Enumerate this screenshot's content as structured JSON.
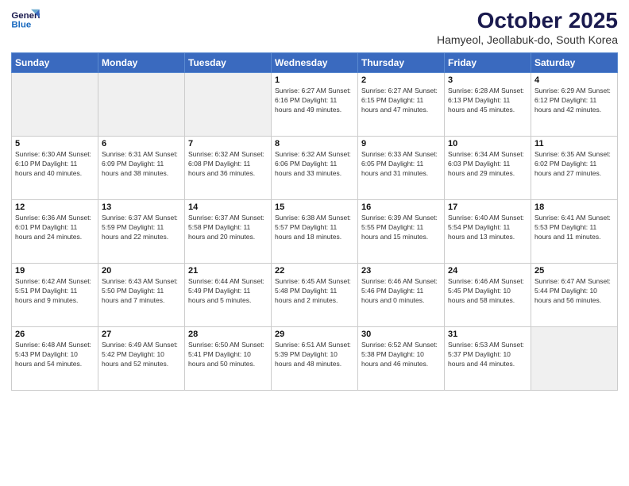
{
  "header": {
    "logo_line1": "General",
    "logo_line2": "Blue",
    "month": "October 2025",
    "location": "Hamyeol, Jeollabuk-do, South Korea"
  },
  "weekdays": [
    "Sunday",
    "Monday",
    "Tuesday",
    "Wednesday",
    "Thursday",
    "Friday",
    "Saturday"
  ],
  "weeks": [
    [
      {
        "day": "",
        "info": "",
        "empty": true
      },
      {
        "day": "",
        "info": "",
        "empty": true
      },
      {
        "day": "",
        "info": "",
        "empty": true
      },
      {
        "day": "1",
        "info": "Sunrise: 6:27 AM\nSunset: 6:16 PM\nDaylight: 11 hours\nand 49 minutes.",
        "empty": false
      },
      {
        "day": "2",
        "info": "Sunrise: 6:27 AM\nSunset: 6:15 PM\nDaylight: 11 hours\nand 47 minutes.",
        "empty": false
      },
      {
        "day": "3",
        "info": "Sunrise: 6:28 AM\nSunset: 6:13 PM\nDaylight: 11 hours\nand 45 minutes.",
        "empty": false
      },
      {
        "day": "4",
        "info": "Sunrise: 6:29 AM\nSunset: 6:12 PM\nDaylight: 11 hours\nand 42 minutes.",
        "empty": false
      }
    ],
    [
      {
        "day": "5",
        "info": "Sunrise: 6:30 AM\nSunset: 6:10 PM\nDaylight: 11 hours\nand 40 minutes.",
        "empty": false
      },
      {
        "day": "6",
        "info": "Sunrise: 6:31 AM\nSunset: 6:09 PM\nDaylight: 11 hours\nand 38 minutes.",
        "empty": false
      },
      {
        "day": "7",
        "info": "Sunrise: 6:32 AM\nSunset: 6:08 PM\nDaylight: 11 hours\nand 36 minutes.",
        "empty": false
      },
      {
        "day": "8",
        "info": "Sunrise: 6:32 AM\nSunset: 6:06 PM\nDaylight: 11 hours\nand 33 minutes.",
        "empty": false
      },
      {
        "day": "9",
        "info": "Sunrise: 6:33 AM\nSunset: 6:05 PM\nDaylight: 11 hours\nand 31 minutes.",
        "empty": false
      },
      {
        "day": "10",
        "info": "Sunrise: 6:34 AM\nSunset: 6:03 PM\nDaylight: 11 hours\nand 29 minutes.",
        "empty": false
      },
      {
        "day": "11",
        "info": "Sunrise: 6:35 AM\nSunset: 6:02 PM\nDaylight: 11 hours\nand 27 minutes.",
        "empty": false
      }
    ],
    [
      {
        "day": "12",
        "info": "Sunrise: 6:36 AM\nSunset: 6:01 PM\nDaylight: 11 hours\nand 24 minutes.",
        "empty": false
      },
      {
        "day": "13",
        "info": "Sunrise: 6:37 AM\nSunset: 5:59 PM\nDaylight: 11 hours\nand 22 minutes.",
        "empty": false
      },
      {
        "day": "14",
        "info": "Sunrise: 6:37 AM\nSunset: 5:58 PM\nDaylight: 11 hours\nand 20 minutes.",
        "empty": false
      },
      {
        "day": "15",
        "info": "Sunrise: 6:38 AM\nSunset: 5:57 PM\nDaylight: 11 hours\nand 18 minutes.",
        "empty": false
      },
      {
        "day": "16",
        "info": "Sunrise: 6:39 AM\nSunset: 5:55 PM\nDaylight: 11 hours\nand 15 minutes.",
        "empty": false
      },
      {
        "day": "17",
        "info": "Sunrise: 6:40 AM\nSunset: 5:54 PM\nDaylight: 11 hours\nand 13 minutes.",
        "empty": false
      },
      {
        "day": "18",
        "info": "Sunrise: 6:41 AM\nSunset: 5:53 PM\nDaylight: 11 hours\nand 11 minutes.",
        "empty": false
      }
    ],
    [
      {
        "day": "19",
        "info": "Sunrise: 6:42 AM\nSunset: 5:51 PM\nDaylight: 11 hours\nand 9 minutes.",
        "empty": false
      },
      {
        "day": "20",
        "info": "Sunrise: 6:43 AM\nSunset: 5:50 PM\nDaylight: 11 hours\nand 7 minutes.",
        "empty": false
      },
      {
        "day": "21",
        "info": "Sunrise: 6:44 AM\nSunset: 5:49 PM\nDaylight: 11 hours\nand 5 minutes.",
        "empty": false
      },
      {
        "day": "22",
        "info": "Sunrise: 6:45 AM\nSunset: 5:48 PM\nDaylight: 11 hours\nand 2 minutes.",
        "empty": false
      },
      {
        "day": "23",
        "info": "Sunrise: 6:46 AM\nSunset: 5:46 PM\nDaylight: 11 hours\nand 0 minutes.",
        "empty": false
      },
      {
        "day": "24",
        "info": "Sunrise: 6:46 AM\nSunset: 5:45 PM\nDaylight: 10 hours\nand 58 minutes.",
        "empty": false
      },
      {
        "day": "25",
        "info": "Sunrise: 6:47 AM\nSunset: 5:44 PM\nDaylight: 10 hours\nand 56 minutes.",
        "empty": false
      }
    ],
    [
      {
        "day": "26",
        "info": "Sunrise: 6:48 AM\nSunset: 5:43 PM\nDaylight: 10 hours\nand 54 minutes.",
        "empty": false
      },
      {
        "day": "27",
        "info": "Sunrise: 6:49 AM\nSunset: 5:42 PM\nDaylight: 10 hours\nand 52 minutes.",
        "empty": false
      },
      {
        "day": "28",
        "info": "Sunrise: 6:50 AM\nSunset: 5:41 PM\nDaylight: 10 hours\nand 50 minutes.",
        "empty": false
      },
      {
        "day": "29",
        "info": "Sunrise: 6:51 AM\nSunset: 5:39 PM\nDaylight: 10 hours\nand 48 minutes.",
        "empty": false
      },
      {
        "day": "30",
        "info": "Sunrise: 6:52 AM\nSunset: 5:38 PM\nDaylight: 10 hours\nand 46 minutes.",
        "empty": false
      },
      {
        "day": "31",
        "info": "Sunrise: 6:53 AM\nSunset: 5:37 PM\nDaylight: 10 hours\nand 44 minutes.",
        "empty": false
      },
      {
        "day": "",
        "info": "",
        "empty": true
      }
    ]
  ]
}
